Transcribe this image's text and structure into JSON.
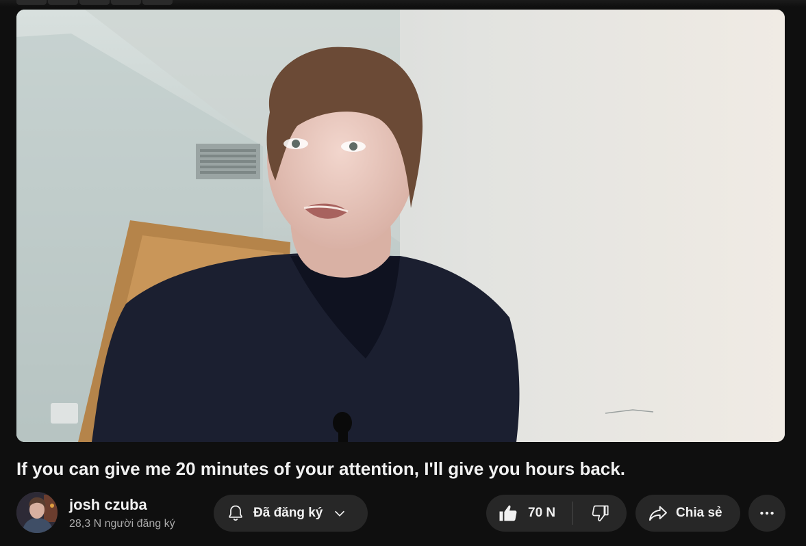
{
  "video": {
    "title": "If you can give me 20 minutes of your attention, I'll give you hours back."
  },
  "channel": {
    "name": "josh czuba",
    "subscribers": "28,3 N người đăng ký"
  },
  "actions": {
    "subscribe_label": "Đã đăng ký",
    "like_count": "70 N",
    "share_label": "Chia sẻ"
  },
  "colors": {
    "background": "#0f0f0f",
    "button_bg": "#272727",
    "text_primary": "#f1f1f1",
    "text_secondary": "#aaaaaa"
  },
  "icons": {
    "subscribe": "bell-icon",
    "subscribe_menu": "chevron-down-icon",
    "like": "thumbs-up-icon",
    "dislike": "thumbs-down-icon",
    "share": "share-arrow-icon",
    "more": "more-horizontal-icon"
  }
}
